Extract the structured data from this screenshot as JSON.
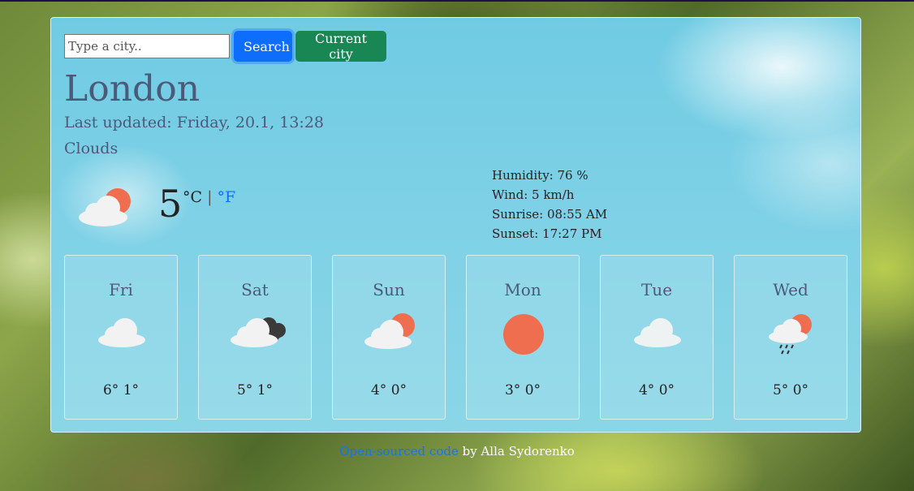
{
  "search": {
    "placeholder": "Type a city..",
    "value": ""
  },
  "buttons": {
    "search_label": "Search",
    "current_label": "Current city"
  },
  "weather": {
    "city": "London",
    "updated": "Last updated: Friday, 20.1, 13:28",
    "description": "Clouds",
    "temperature": "5",
    "unit_c": "°C",
    "unit_sep": "|",
    "unit_f": "°F",
    "icon": "partly-cloudy-icon",
    "humidity": "Humidity: 76 %",
    "wind": "Wind: 5 km/h",
    "sunrise": "Sunrise: 08:55 AM",
    "sunset": "Sunset: 17:27 PM"
  },
  "forecast": [
    {
      "day": "Fri",
      "icon": "cloud-icon",
      "temps": "6° 1°"
    },
    {
      "day": "Sat",
      "icon": "cloudy-dark-icon",
      "temps": "5° 1°"
    },
    {
      "day": "Sun",
      "icon": "partly-cloudy-icon",
      "temps": "4° 0°"
    },
    {
      "day": "Mon",
      "icon": "sun-icon",
      "temps": "3° 0°"
    },
    {
      "day": "Tue",
      "icon": "cloud-icon",
      "temps": "4° 0°"
    },
    {
      "day": "Wed",
      "icon": "rain-sun-icon",
      "temps": "5° 0°"
    }
  ],
  "footer": {
    "link_text": "Open-sourced code",
    "suffix": " by Alla Sydorenko"
  },
  "colors": {
    "search_button": "#0d6efd",
    "current_button": "#198754",
    "sun": "#ee6e4f",
    "link": "#1a73e8"
  }
}
